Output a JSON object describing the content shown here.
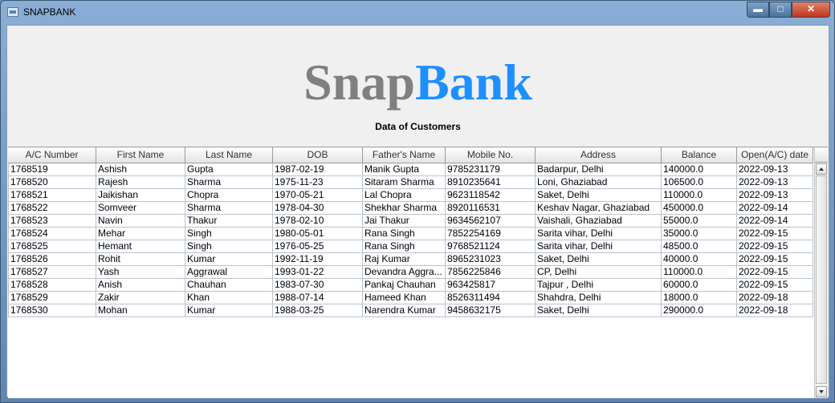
{
  "window": {
    "title": "SNAPBANK"
  },
  "logo": {
    "part1": "Snap",
    "part2": "Bank"
  },
  "subtitle": "Data of Customers",
  "table": {
    "columns": [
      "A/C Number",
      "First Name",
      "Last Name",
      "DOB",
      "Father's Name",
      "Mobile No.",
      "Address",
      "Balance",
      "Open(A/C) date"
    ],
    "rows": [
      [
        "1768519",
        "Ashish",
        "Gupta",
        "1987-02-19",
        "Manik Gupta",
        "9785231179",
        " Badarpur, Delhi",
        "140000.0",
        "2022-09-13"
      ],
      [
        "1768520",
        "Rajesh",
        "Sharma",
        "1975-11-23",
        "Sitaram Sharma",
        "8910235641",
        "Loni, Ghaziabad",
        "106500.0",
        "2022-09-13"
      ],
      [
        "1768521",
        "Jaikishan",
        "Chopra",
        "1970-05-21",
        "Lal Chopra",
        "9623118542",
        "Saket, Delhi",
        "110000.0",
        "2022-09-13"
      ],
      [
        "1768522",
        "Somveer",
        "Sharma",
        "1978-04-30",
        "Shekhar Sharma",
        "8920116531",
        "Keshav Nagar, Ghaziabad",
        "450000.0",
        "2022-09-14"
      ],
      [
        "1768523",
        "Navin",
        "Thakur",
        "1978-02-10",
        "Jai Thakur",
        "9634562107",
        "Vaishali, Ghaziabad",
        "55000.0",
        "2022-09-14"
      ],
      [
        "1768524",
        "Mehar",
        "Singh",
        "1980-05-01",
        "Rana Singh",
        "7852254169",
        "Sarita vihar, Delhi",
        "35000.0",
        "2022-09-15"
      ],
      [
        "1768525",
        "Hemant",
        "Singh",
        "1976-05-25",
        "Rana Singh",
        "9768521124",
        "Sarita vihar, Delhi",
        "48500.0",
        "2022-09-15"
      ],
      [
        "1768526",
        "Rohit",
        "Kumar",
        "1992-11-19",
        "Raj Kumar",
        "8965231023",
        "Saket, Delhi",
        "40000.0",
        "2022-09-15"
      ],
      [
        "1768527",
        "Yash",
        "Aggrawal",
        "1993-01-22",
        "Devandra Aggra...",
        "7856225846",
        "CP, Delhi",
        "110000.0",
        "2022-09-15"
      ],
      [
        "1768528",
        "Anish",
        "Chauhan",
        "1983-07-30",
        "Pankaj Chauhan",
        "963425817",
        "Tajpur , Delhi",
        "60000.0",
        "2022-09-15"
      ],
      [
        "1768529",
        "Zakir",
        "Khan",
        "1988-07-14",
        "Hameed Khan",
        "8526311494",
        "Shahdra, Delhi",
        "18000.0",
        "2022-09-18"
      ],
      [
        "1768530",
        "Mohan",
        "Kumar",
        "1988-03-25",
        "Narendra Kumar",
        "9458632175",
        "Saket, Delhi",
        "290000.0",
        "2022-09-18"
      ]
    ]
  },
  "colors": {
    "logo_gray": "#808080",
    "logo_blue": "#1e8fff"
  },
  "icons": {
    "minimize": "minimize-icon",
    "maximize": "maximize-icon",
    "close": "close-icon"
  }
}
